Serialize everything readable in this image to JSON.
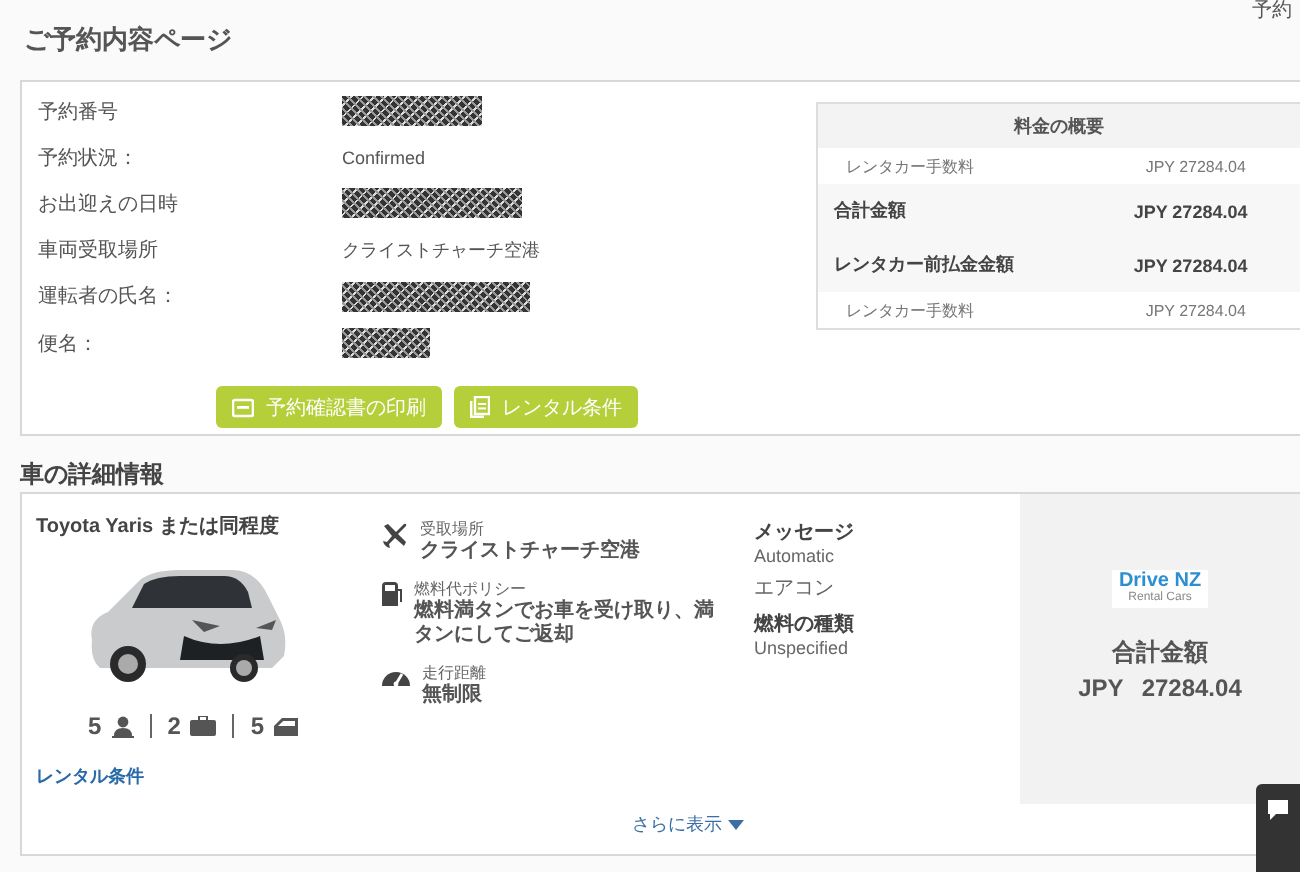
{
  "corner_text": "予約",
  "page_title": "ご予約内容ページ",
  "booking": {
    "rows": [
      {
        "label": "予約番号",
        "kind": "redacted"
      },
      {
        "label": "予約状況：",
        "kind": "text",
        "value": "Confirmed"
      },
      {
        "label": "お出迎えの日時",
        "kind": "redacted"
      },
      {
        "label": "車両受取場所",
        "kind": "text",
        "value": "クライストチャーチ空港"
      },
      {
        "label": "運転者の氏名：",
        "kind": "redacted"
      },
      {
        "label": "便名：",
        "kind": "redacted"
      }
    ],
    "buttons": [
      {
        "label": "予約確認書の印刷"
      },
      {
        "label": "レンタル条件"
      }
    ]
  },
  "price_summary": {
    "title": "料金の概要",
    "rows": [
      {
        "kind": "item",
        "label": "レンタカー手数料",
        "amount": "JPY 27284.04"
      },
      {
        "kind": "total",
        "label": "合計金額",
        "amount": "JPY 27284.04"
      },
      {
        "kind": "total",
        "label": "レンタカー前払金金額",
        "amount": "JPY 27284.04"
      },
      {
        "kind": "item",
        "label": "レンタカー手数料",
        "amount": "JPY 27284.04"
      }
    ]
  },
  "car_section": {
    "title": "車の詳細情報",
    "car_name": "Toyota Yaris または同程度",
    "specs": [
      {
        "count": "5"
      },
      {
        "count": "2"
      },
      {
        "count": "5"
      }
    ],
    "terms_link": "レンタル条件",
    "features": [
      {
        "label": "受取場所",
        "value": "クライストチャーチ空港"
      },
      {
        "label": "燃料代ポリシー",
        "value": "燃料満タンでお車を受け取り、満タンにしてご返却"
      },
      {
        "label": "走行距離",
        "value": "無制限"
      }
    ],
    "details": [
      {
        "label": "メッセージ",
        "value": "Automatic"
      },
      {
        "label": "エアコン"
      },
      {
        "label": "燃料の種類",
        "value": "Unspecified"
      }
    ],
    "supplier_logo": {
      "line1": "Drive NZ",
      "line2": "Rental Cars"
    },
    "total_label": "合計金額",
    "total_currency": "JPY",
    "total_amount": "27284.04",
    "more_link": "さらに表示"
  }
}
